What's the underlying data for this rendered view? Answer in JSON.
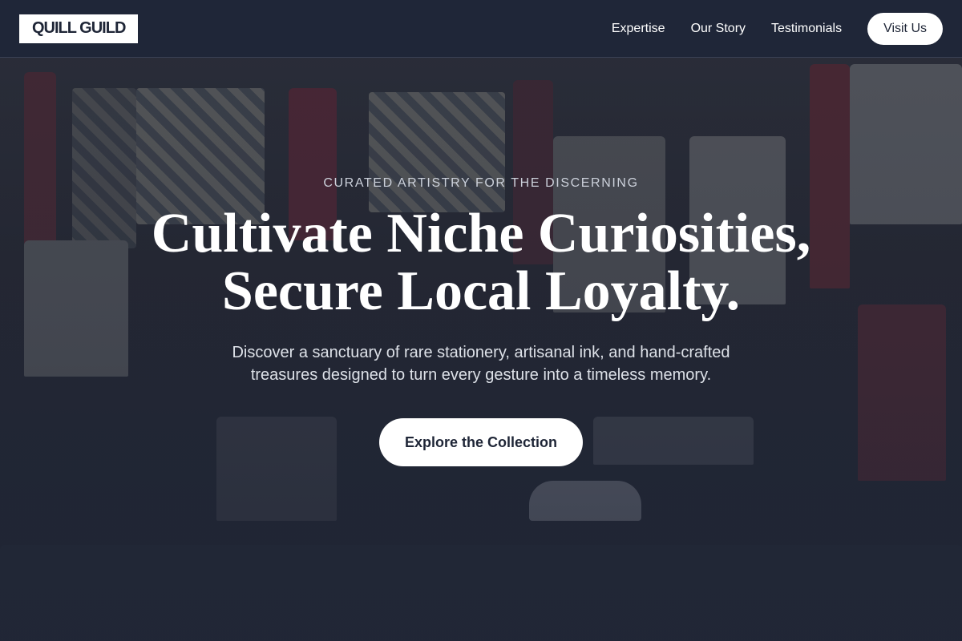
{
  "navbar": {
    "logo": "QUILL GUILD",
    "links": [
      "Expertise",
      "Our Story",
      "Testimonials"
    ],
    "visit_label": "Visit Us"
  },
  "hero": {
    "eyebrow": "CURATED ARTISTRY FOR THE DISCERNING",
    "headline_line1": "Cultivate Niche Curiosities,",
    "headline_line2": "Secure Local Loyalty.",
    "subtext": "Discover a sanctuary of rare stationery, artisanal ink, and hand-crafted treasures designed to turn every gesture into a timeless memory.",
    "cta_label": "Explore the Collection",
    "background_image": "market-stall-photo"
  },
  "colors": {
    "navy": "#1e2536",
    "white": "#ffffff"
  }
}
